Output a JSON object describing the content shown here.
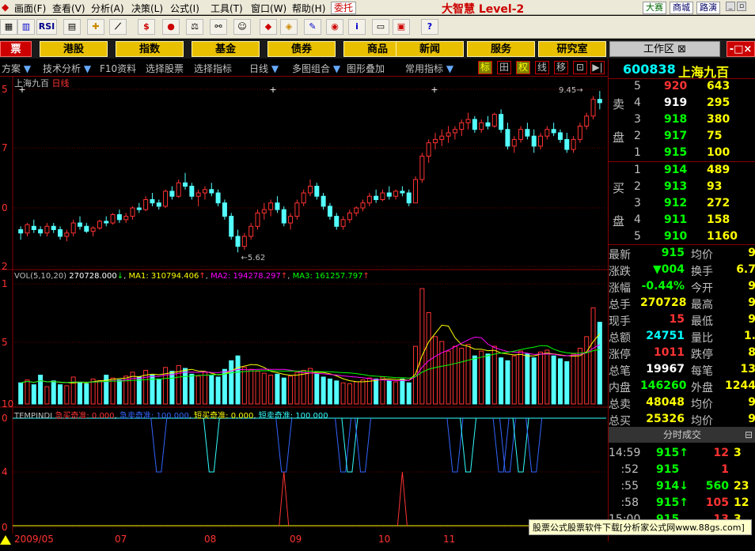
{
  "menu": [
    "画面(F)",
    "查看(V)",
    "分析(A)",
    "决策(L)",
    "公式(I)",
    "工具(T)",
    "窗口(W)",
    "帮助(H)"
  ],
  "entrust_label": "委托",
  "logo_text": "大智慧 Level-2",
  "right_buttons": [
    "大赛",
    "商城",
    "路演"
  ],
  "toolbar_icons": [
    "grid-icon",
    "chart-icon",
    "rsi-icon",
    "crosshair-icon",
    "ruler-icon",
    "dollar-icon",
    "traffic-icon",
    "compare-icon",
    "binoculars-icon",
    "diamond-icon",
    "alert-icon",
    "pen-icon",
    "cd-icon",
    "info-icon",
    "page-icon",
    "note-icon",
    "book-icon",
    "help-icon"
  ],
  "nav": {
    "left_label": "票",
    "buttons": [
      "港股",
      "指数",
      "基金",
      "债券",
      "商品",
      "新闻",
      "服务",
      "研究室"
    ],
    "workspace_label": "工作区"
  },
  "chart_toolbar": {
    "items": [
      "方案",
      "技术分析",
      "F10资料",
      "选择股票",
      "选择指标",
      "日线",
      "多图组合",
      "图形叠加",
      "常用指标"
    ],
    "toggles": [
      "标",
      "田",
      "权",
      "线",
      "移",
      "⊡",
      "▶|"
    ]
  },
  "chart_data": {
    "type": "candlestick",
    "title": "上海九百",
    "period": "日线",
    "price_axis": {
      "min": 5.2,
      "max": 10.5,
      "labels": [
        "5",
        "7",
        "0",
        "2"
      ]
    },
    "x_labels": [
      "2009/05",
      "07",
      "08",
      "09",
      "10",
      "11"
    ],
    "annotations": [
      {
        "text": "5.62"
      },
      {
        "text": "9.45"
      }
    ],
    "candles": [
      [
        6.3,
        6.4,
        6.0,
        6.2
      ],
      [
        6.2,
        6.5,
        6.1,
        6.45
      ],
      [
        6.4,
        6.6,
        6.2,
        6.3
      ],
      [
        6.3,
        6.4,
        6.1,
        6.2
      ],
      [
        6.2,
        6.5,
        6.1,
        6.4
      ],
      [
        6.4,
        6.5,
        6.2,
        6.3
      ],
      [
        6.3,
        6.4,
        6.0,
        6.1
      ],
      [
        6.1,
        6.3,
        5.95,
        6.2
      ],
      [
        6.2,
        6.6,
        6.1,
        6.5
      ],
      [
        6.5,
        6.7,
        6.3,
        6.4
      ],
      [
        6.4,
        6.5,
        6.2,
        6.25
      ],
      [
        6.25,
        6.4,
        6.1,
        6.35
      ],
      [
        6.35,
        6.6,
        6.3,
        6.55
      ],
      [
        6.55,
        6.7,
        6.4,
        6.5
      ],
      [
        6.5,
        6.8,
        6.45,
        6.75
      ],
      [
        6.75,
        6.9,
        6.5,
        6.6
      ],
      [
        6.6,
        6.8,
        6.5,
        6.7
      ],
      [
        6.7,
        7.0,
        6.6,
        6.95
      ],
      [
        6.95,
        7.1,
        6.8,
        6.9
      ],
      [
        6.9,
        7.3,
        6.85,
        7.2
      ],
      [
        7.2,
        7.4,
        7.0,
        7.1
      ],
      [
        7.1,
        7.2,
        6.9,
        7.0
      ],
      [
        7.0,
        7.5,
        6.95,
        7.45
      ],
      [
        7.45,
        7.6,
        7.2,
        7.3
      ],
      [
        7.3,
        7.8,
        7.25,
        7.7
      ],
      [
        7.7,
        8.0,
        7.5,
        7.6
      ],
      [
        7.6,
        7.7,
        7.2,
        7.3
      ],
      [
        7.3,
        7.5,
        7.0,
        7.4
      ],
      [
        7.4,
        7.6,
        7.2,
        7.5
      ],
      [
        7.5,
        7.7,
        7.3,
        7.4
      ],
      [
        7.4,
        7.5,
        7.0,
        7.1
      ],
      [
        7.1,
        7.2,
        6.6,
        6.7
      ],
      [
        6.7,
        6.8,
        6.0,
        6.1
      ],
      [
        6.1,
        6.3,
        5.62,
        5.8
      ],
      [
        5.8,
        6.2,
        5.7,
        6.1
      ],
      [
        6.1,
        6.5,
        6.0,
        6.4
      ],
      [
        6.4,
        6.9,
        6.3,
        6.8
      ],
      [
        6.8,
        7.1,
        6.6,
        6.9
      ],
      [
        6.9,
        7.2,
        6.7,
        7.1
      ],
      [
        7.1,
        7.3,
        6.8,
        6.9
      ],
      [
        6.9,
        7.0,
        6.4,
        6.5
      ],
      [
        6.5,
        6.8,
        6.3,
        6.7
      ],
      [
        6.7,
        7.2,
        6.6,
        7.1
      ],
      [
        7.1,
        7.5,
        7.0,
        7.4
      ],
      [
        7.4,
        7.8,
        7.3,
        7.6
      ],
      [
        7.6,
        7.7,
        7.2,
        7.3
      ],
      [
        7.3,
        7.4,
        6.9,
        7.0
      ],
      [
        7.0,
        7.1,
        6.6,
        6.7
      ],
      [
        6.7,
        6.8,
        6.3,
        6.4
      ],
      [
        6.4,
        6.7,
        6.3,
        6.6
      ],
      [
        6.6,
        6.9,
        6.5,
        6.8
      ],
      [
        6.8,
        7.0,
        6.7,
        6.95
      ],
      [
        6.95,
        7.2,
        6.85,
        7.1
      ],
      [
        7.1,
        7.4,
        7.0,
        7.3
      ],
      [
        7.3,
        7.5,
        7.1,
        7.2
      ],
      [
        7.2,
        7.5,
        7.15,
        7.4
      ],
      [
        7.4,
        7.6,
        7.2,
        7.3
      ],
      [
        7.3,
        7.5,
        7.2,
        7.45
      ],
      [
        7.45,
        7.6,
        7.3,
        7.4
      ],
      [
        7.4,
        7.5,
        7.0,
        7.1
      ],
      [
        7.1,
        7.9,
        7.1,
        7.8
      ],
      [
        7.8,
        8.6,
        7.7,
        8.5
      ],
      [
        8.5,
        9.0,
        8.3,
        8.9
      ],
      [
        8.9,
        9.2,
        8.7,
        9.0
      ],
      [
        9.0,
        9.3,
        8.8,
        9.1
      ],
      [
        9.1,
        9.4,
        8.9,
        9.2
      ],
      [
        9.2,
        9.4,
        9.0,
        9.3
      ],
      [
        9.3,
        9.6,
        9.1,
        9.5
      ],
      [
        9.5,
        9.8,
        9.3,
        9.6
      ],
      [
        9.6,
        9.7,
        9.2,
        9.3
      ],
      [
        9.3,
        9.6,
        9.2,
        9.5
      ],
      [
        9.5,
        9.7,
        9.3,
        9.4
      ],
      [
        9.4,
        9.8,
        9.35,
        9.75
      ],
      [
        9.75,
        9.9,
        9.2,
        9.3
      ],
      [
        9.3,
        9.5,
        8.7,
        8.8
      ],
      [
        8.8,
        9.1,
        8.6,
        9.0
      ],
      [
        9.0,
        9.4,
        8.9,
        9.3
      ],
      [
        9.3,
        9.5,
        9.0,
        9.1
      ],
      [
        9.1,
        9.3,
        8.6,
        8.8
      ],
      [
        8.8,
        9.2,
        8.7,
        9.1
      ],
      [
        9.1,
        9.4,
        9.0,
        9.3
      ],
      [
        9.3,
        9.5,
        9.1,
        9.2
      ],
      [
        9.2,
        9.3,
        8.9,
        9.0
      ],
      [
        9.0,
        9.2,
        8.6,
        8.7
      ],
      [
        8.7,
        9.1,
        8.6,
        9.0
      ],
      [
        9.0,
        9.5,
        8.9,
        9.4
      ],
      [
        9.4,
        9.8,
        9.3,
        9.7
      ],
      [
        9.7,
        10.3,
        9.6,
        10.2
      ],
      [
        10.2,
        10.45,
        9.9,
        10.1
      ]
    ],
    "volume": {
      "header": "VOL(5,10,20)",
      "value": "270728.000",
      "ma1": "MA1: 310794.406",
      "ma2": "MA2: 194278.297",
      "ma3": "MA3: 161257.797",
      "axis_labels": [
        "1",
        "5",
        "10"
      ],
      "bars": [
        22,
        25,
        20,
        30,
        18,
        24,
        20,
        19,
        28,
        22,
        21,
        26,
        24,
        30,
        27,
        25,
        29,
        33,
        28,
        35,
        30,
        26,
        38,
        34,
        40,
        37,
        31,
        29,
        33,
        30,
        28,
        36,
        45,
        50,
        38,
        36,
        34,
        32,
        30,
        31,
        27,
        29,
        33,
        35,
        37,
        31,
        28,
        26,
        24,
        22,
        21,
        23,
        25,
        27,
        26,
        28,
        24,
        23,
        26,
        22,
        60,
        120,
        95,
        70,
        65,
        55,
        60,
        58,
        62,
        50,
        55,
        52,
        60,
        48,
        45,
        50,
        55,
        52,
        48,
        54,
        56,
        50,
        47,
        44,
        52,
        58,
        70,
        100,
        85
      ]
    },
    "indicator": {
      "header": "TEMPINDI",
      "lines": [
        {
          "label": "急买奇准: 0.000",
          "color": "#ff3333"
        },
        {
          "label": "急卖奇准: 100.000",
          "color": "#3366ff"
        },
        {
          "label": "短买奇准: 0.000",
          "color": "#ffff00"
        },
        {
          "label": "短卖奇准: 100.000",
          "color": "#33ffff"
        }
      ],
      "axis_labels": [
        "0",
        "4",
        "0"
      ],
      "dips": [
        21,
        29,
        40,
        49,
        50,
        52,
        66,
        68,
        73,
        74,
        76,
        78
      ],
      "spikes": [
        40,
        58
      ]
    }
  },
  "quote": {
    "code": "600838",
    "name": "上海九百",
    "sell_label": [
      "卖",
      "盘"
    ],
    "buy_label": [
      "买",
      "盘"
    ],
    "asks": [
      {
        "lv": "5",
        "price": "920",
        "qty": "643",
        "c": "red"
      },
      {
        "lv": "4",
        "price": "919",
        "qty": "295",
        "c": "wht"
      },
      {
        "lv": "3",
        "price": "918",
        "qty": "380",
        "c": "grn"
      },
      {
        "lv": "2",
        "price": "917",
        "qty": "75",
        "c": "grn"
      },
      {
        "lv": "1",
        "price": "915",
        "qty": "100",
        "c": "grn"
      }
    ],
    "bids": [
      {
        "lv": "1",
        "price": "914",
        "qty": "489",
        "c": "grn"
      },
      {
        "lv": "2",
        "price": "913",
        "qty": "93",
        "c": "grn"
      },
      {
        "lv": "3",
        "price": "912",
        "qty": "272",
        "c": "grn"
      },
      {
        "lv": "4",
        "price": "911",
        "qty": "158",
        "c": "grn"
      },
      {
        "lv": "5",
        "price": "910",
        "qty": "1160",
        "c": "grn"
      }
    ],
    "stats": [
      {
        "k1": "最新",
        "v1": "915",
        "c1": "grn",
        "k2": "均价",
        "v2": "9"
      },
      {
        "k1": "涨跌",
        "v1": "▼004",
        "c1": "grn",
        "k2": "换手",
        "v2": "6.7"
      },
      {
        "k1": "涨幅",
        "v1": "-0.44%",
        "c1": "grn",
        "k2": "今开",
        "v2": "9"
      },
      {
        "k1": "总手",
        "v1": "270728",
        "c1": "yel",
        "k2": "最高",
        "v2": "9"
      },
      {
        "k1": "现手",
        "v1": "15",
        "c1": "red",
        "k2": "最低",
        "v2": "9"
      },
      {
        "k1": "总额",
        "v1": "24751",
        "c1": "cyn",
        "k2": "量比",
        "v2": "1."
      },
      {
        "k1": "涨停",
        "v1": "1011",
        "c1": "red",
        "k2": "跌停",
        "v2": "8"
      },
      {
        "k1": "总笔",
        "v1": "19967",
        "c1": "wht",
        "k2": "每笔",
        "v2": "13"
      },
      {
        "k1": "内盘",
        "v1": "146260",
        "c1": "grn",
        "k2": "外盘",
        "v2": "1244"
      },
      {
        "k1": "总卖",
        "v1": "48048",
        "c1": "yel",
        "k2": "均价",
        "v2": "9"
      },
      {
        "k1": "总买",
        "v1": "25326",
        "c1": "yel",
        "k2": "均价",
        "v2": "9"
      }
    ],
    "ticks_title": "分时成交",
    "ticks": [
      {
        "t": "14:59",
        "p": "915↑",
        "v": "12",
        "vc": "red",
        "n": "3"
      },
      {
        "t": ":52",
        "p": "915",
        "v": "1",
        "vc": "red",
        "n": ""
      },
      {
        "t": ":55",
        "p": "914↓",
        "v": "560",
        "vc": "grn",
        "n": "23"
      },
      {
        "t": ":58",
        "p": "915↑",
        "v": "105",
        "vc": "red",
        "n": "12"
      },
      {
        "t": "15:00",
        "p": "915",
        "v": "13",
        "vc": "red",
        "n": "3"
      }
    ]
  },
  "watermark": "股票公式股票软件下载[分析家公式网www.88gs.com]"
}
